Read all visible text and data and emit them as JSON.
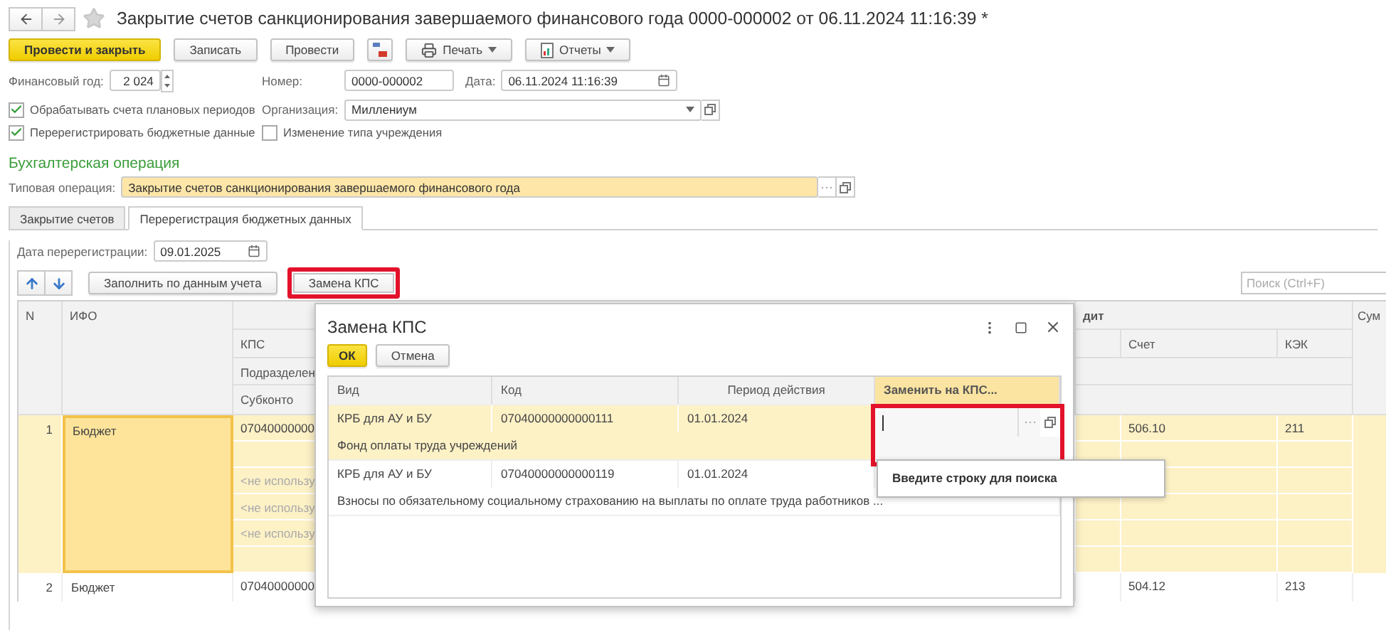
{
  "window": {
    "title": "Закрытие счетов санкционирования завершаемого финансового года 0000-000002 от 06.11.2024 11:16:39 *"
  },
  "toolbar": [
    {
      "kind": "primary",
      "label": "Провести и закрыть"
    },
    {
      "kind": "plain",
      "label": "Записать"
    },
    {
      "kind": "plain",
      "label": "Провести"
    },
    {
      "kind": "icon"
    },
    {
      "kind": "menu",
      "label": "Печать"
    },
    {
      "kind": "menu",
      "label": "Отчеты"
    }
  ],
  "fields": {
    "fiscal_year": {
      "label": "Финансовый год:",
      "value": "2 024"
    },
    "number": {
      "label": "Номер:",
      "value": "0000-000002"
    },
    "date": {
      "label": "Дата:",
      "value": "06.11.2024 11:16:39"
    },
    "organization": {
      "label": "Организация:",
      "value": "Миллениум"
    }
  },
  "checkboxes": [
    {
      "label": "Обрабатывать счета плановых периодов",
      "checked": true
    },
    {
      "label": "Перерегистрировать бюджетные данные",
      "checked": true
    },
    {
      "label": "Изменение типа учреждения",
      "checked": false
    }
  ],
  "section_title": "Бухгалтерская операция",
  "typical_operation": {
    "label": "Типовая операция:",
    "value": "Закрытие счетов санкционирования завершаемого финансового года"
  },
  "tabs": [
    {
      "label": "Закрытие счетов",
      "selected": false
    },
    {
      "label": "Перерегистрация бюджетных данных",
      "selected": true
    }
  ],
  "reregistration_date": {
    "label": "Дата перерегистрации:",
    "value": "09.01.2025"
  },
  "table_toolbar": {
    "buttons": [
      {
        "label": "Заполнить по данным учета",
        "highlighted": false
      },
      {
        "label": "Замена КПС",
        "highlighted": true
      }
    ],
    "search": {
      "placeholder": "Поиск (Ctrl+F)"
    }
  },
  "table": {
    "columns": {
      "n": "N",
      "ifo": "ИФО",
      "kps": "КПС",
      "department": "Подразделен",
      "subconto": "Субконто",
      "credit": "дит",
      "account": "Счет",
      "kek": "КЭК",
      "sum": "Сум"
    },
    "rows": [
      {
        "n": "1",
        "ifo": "Бюджет",
        "kps": "07040000000",
        "subconto_lines": [
          "<не использу",
          "<не использу",
          "<не использу"
        ],
        "account": "506.10",
        "kek": "211",
        "selected": true
      },
      {
        "n": "2",
        "ifo": "Бюджет",
        "kps": "07040000000",
        "account": "504.12",
        "kek": "213",
        "selected": false
      }
    ]
  },
  "dialog": {
    "title": "Замена КПС",
    "buttons": [
      {
        "kind": "primary",
        "label": "ОК"
      },
      {
        "kind": "plain",
        "label": "Отмена"
      }
    ],
    "columns": [
      {
        "label": "Вид",
        "selected": false
      },
      {
        "label": "Код",
        "selected": false
      },
      {
        "label": "Период действия",
        "selected": false
      },
      {
        "label": "Заменить на КПС...",
        "selected": true
      }
    ],
    "rows": [
      {
        "type": "КРБ для АУ и БУ",
        "code": "07040000000000111",
        "period": "01.01.2024",
        "name": "Фонд оплаты труда учреждений",
        "selected": true,
        "editing": true
      },
      {
        "type": "КРБ для АУ и БУ",
        "code": "07040000000000119",
        "period": "01.01.2024",
        "name": "Взносы по обязательному социальному страхованию на выплаты по оплате труда работников ...",
        "selected": false,
        "editing": false
      }
    ],
    "edit_field": {
      "highlighted": true
    },
    "dropdown": {
      "text": "Введите строку для поиска"
    }
  }
}
